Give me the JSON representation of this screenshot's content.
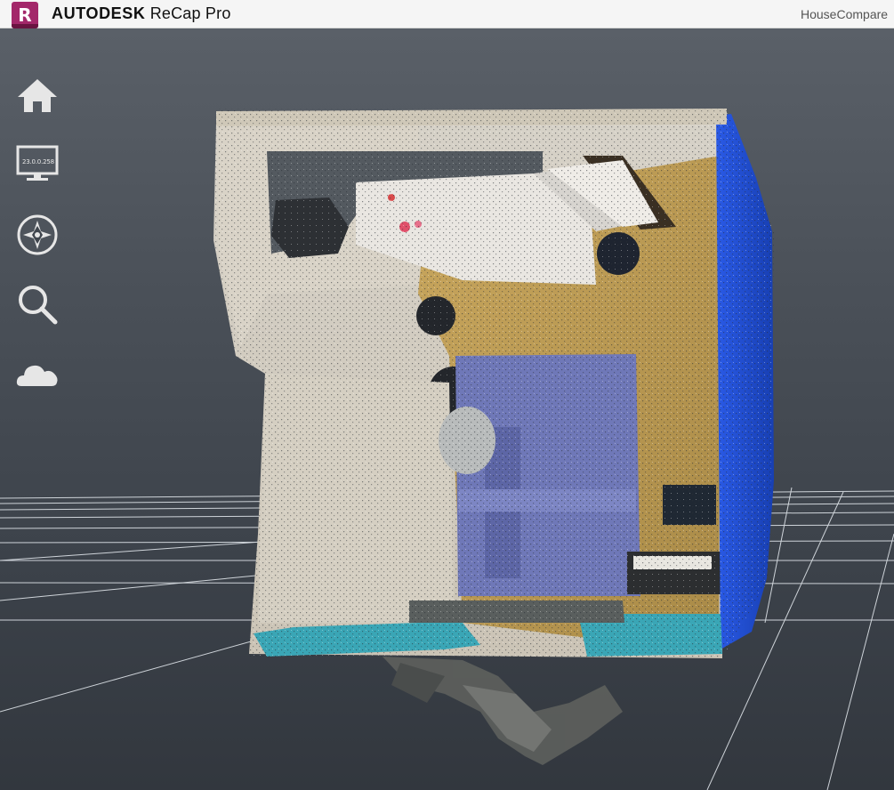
{
  "titlebar": {
    "logo_letter": "R",
    "brand_bold": "AUTODESK",
    "brand_product": "ReCap Pro",
    "project_name": "HouseCompare"
  },
  "toolbar": {
    "items": [
      {
        "icon": "home-icon",
        "label": ""
      },
      {
        "icon": "monitor-icon",
        "label": "23.0.0.258"
      },
      {
        "icon": "compass-navigation-icon",
        "label": ""
      },
      {
        "icon": "search-icon",
        "label": ""
      },
      {
        "icon": "cloud-icon",
        "label": ""
      }
    ]
  },
  "colors": {
    "titlebar_bg": "#f5f5f5",
    "logo": "#a3286a",
    "viewport_bg": "#3b414a",
    "icon": "#e6e6e6",
    "wall_blue": "#1f4fd8",
    "sofa": "#6f78b8",
    "floor_wood": "#b9964f",
    "rug_teal": "#3aa6b6"
  }
}
